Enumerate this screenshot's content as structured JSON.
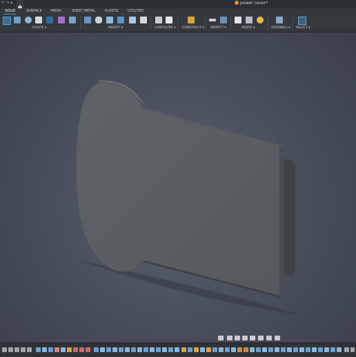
{
  "titlebar": {
    "document_title": "power cover*",
    "controls": [
      "↶",
      "↷",
      "▾"
    ],
    "home_icon": "home-icon"
  },
  "toolbar": {
    "tabs": [
      {
        "label": "SOLID",
        "active": true
      },
      {
        "label": "SURFACE",
        "active": false
      },
      {
        "label": "MESH",
        "active": false
      },
      {
        "label": "SHEET METAL",
        "active": false
      },
      {
        "label": "PLASTIC",
        "active": false
      },
      {
        "label": "UTILITIES",
        "active": false
      }
    ],
    "groups": [
      {
        "label": "CREATE ▾"
      },
      {
        "label": "MODIFY ▾"
      },
      {
        "label": "CONFIGURE ▾"
      },
      {
        "label": "CONSTRUCT ▾"
      },
      {
        "label": "INSPECT ▾"
      },
      {
        "label": "INSERT ▾"
      },
      {
        "label": "ASSEMBLE ▾"
      },
      {
        "label": "SELECT ▾"
      }
    ]
  },
  "colors": {
    "accent": "#4aa0e6",
    "part_fill": "#5b5e63",
    "part_edge": "#44474c",
    "viewport_center": "#5c6371"
  }
}
